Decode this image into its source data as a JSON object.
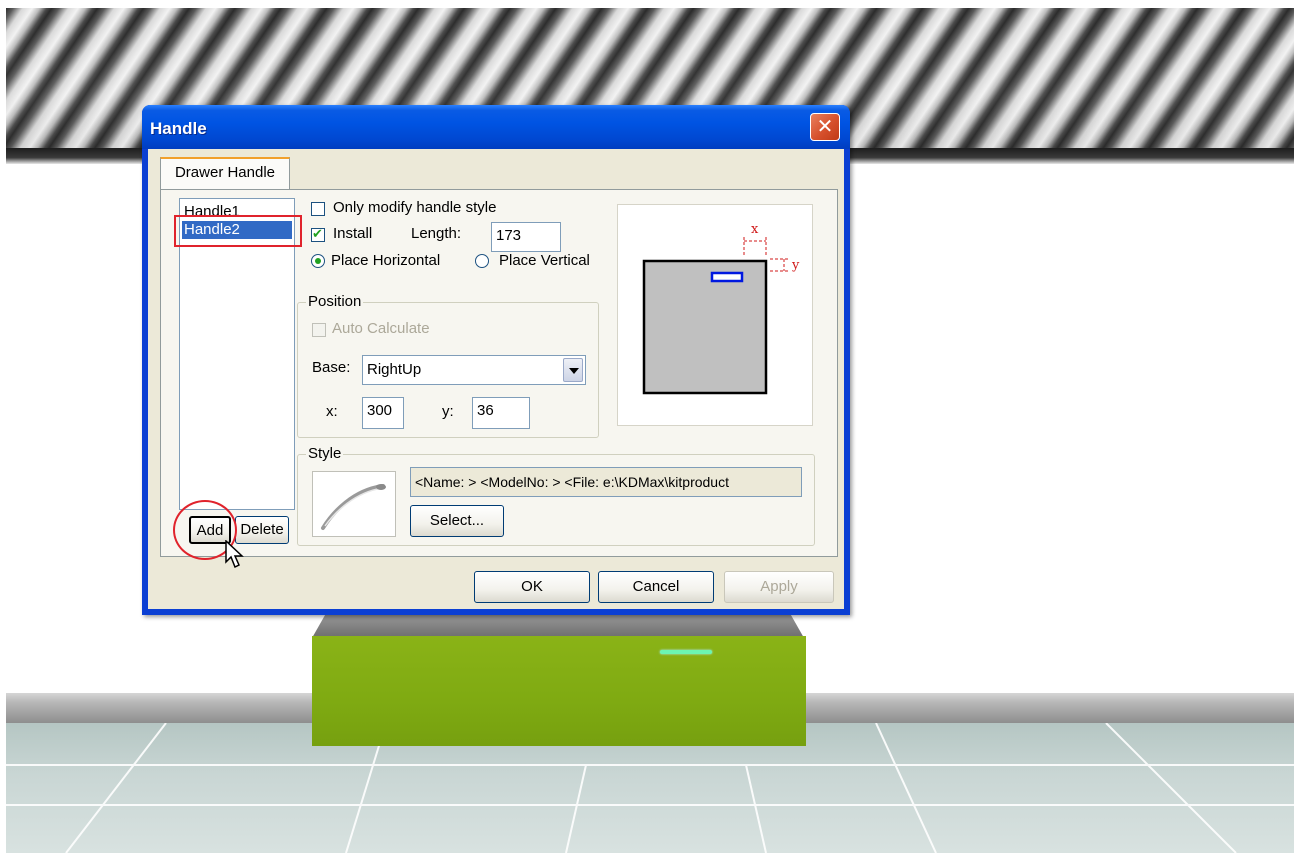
{
  "dialog": {
    "title": "Handle",
    "close_glyph": "✕",
    "tab_label": "Drawer Handle"
  },
  "handle_list": {
    "items": [
      "Handle1",
      "Handle2"
    ],
    "selected": "Handle2",
    "add_label": "Add",
    "delete_label": "Delete"
  },
  "options": {
    "only_modify_label": "Only modify handle style",
    "only_modify_checked": false,
    "install_label": "Install",
    "install_checked": true,
    "length_label": "Length:",
    "length_value": "173",
    "horizontal_label": "Place Horizontal",
    "vertical_label": "Place Vertical",
    "placement": "horizontal"
  },
  "position": {
    "group_title": "Position",
    "auto_calc_label": "Auto Calculate",
    "base_label": "Base:",
    "base_value": "RightUp",
    "x_label": "x:",
    "x_value": "300",
    "y_label": "y:",
    "y_value": "36"
  },
  "preview": {
    "x_marker": "x",
    "y_marker": "y"
  },
  "style": {
    "group_title": "Style",
    "info_text": "<Name: > <ModelNo: > <File: e:\\KDMax\\kitproduct",
    "select_label": "Select..."
  },
  "footer": {
    "ok_label": "OK",
    "cancel_label": "Cancel",
    "apply_label": "Apply"
  },
  "icons": {
    "close": "close-icon",
    "dropdown": "chevron-down-icon",
    "cursor": "mouse-pointer-icon",
    "handle_thumbnail": "drawer-handle-icon"
  },
  "colors": {
    "titlebar": "#0054e3",
    "selection": "#316ac5",
    "annotation_red": "#e0232c",
    "drawer_green": "#7faa12"
  }
}
